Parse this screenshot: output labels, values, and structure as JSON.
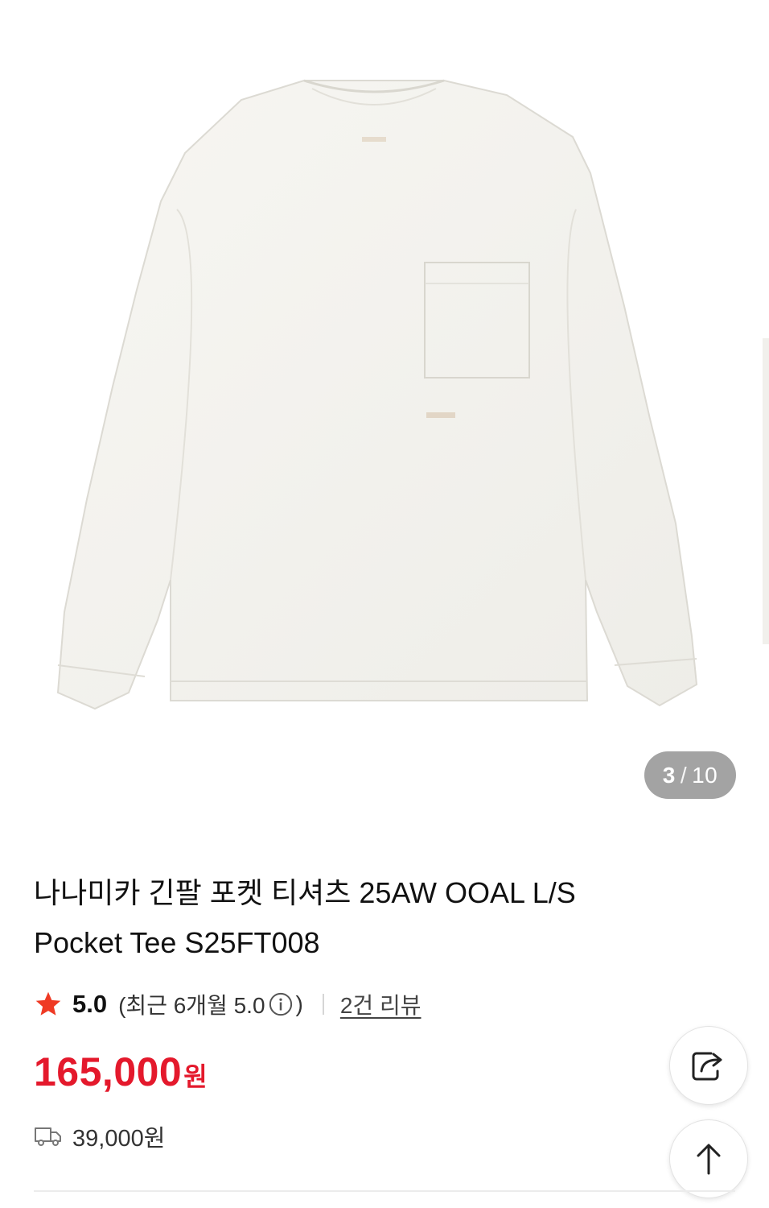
{
  "gallery": {
    "image_alt": "white long sleeve pocket tee",
    "current_index": "3",
    "separator": "/",
    "total": "10"
  },
  "product": {
    "title": "나나미카 긴팔 포켓 티셔츠 25AW OOAL L/S Pocket Tee S25FT008",
    "rating": "5.0",
    "recent_rating_text": "(최근 6개월 5.0",
    "recent_rating_close": ")",
    "review_link": "2건 리뷰",
    "price_amount": "165,000",
    "price_unit": "원",
    "shipping_fee": "39,000원"
  },
  "icons": {
    "star": "star-icon",
    "info": "info-icon",
    "truck": "truck-icon",
    "share": "share-icon",
    "scroll_top": "arrow-up-icon"
  },
  "colors": {
    "price": "#e4192c",
    "star": "#ef3a24",
    "pager_bg": "#a3a3a3"
  }
}
